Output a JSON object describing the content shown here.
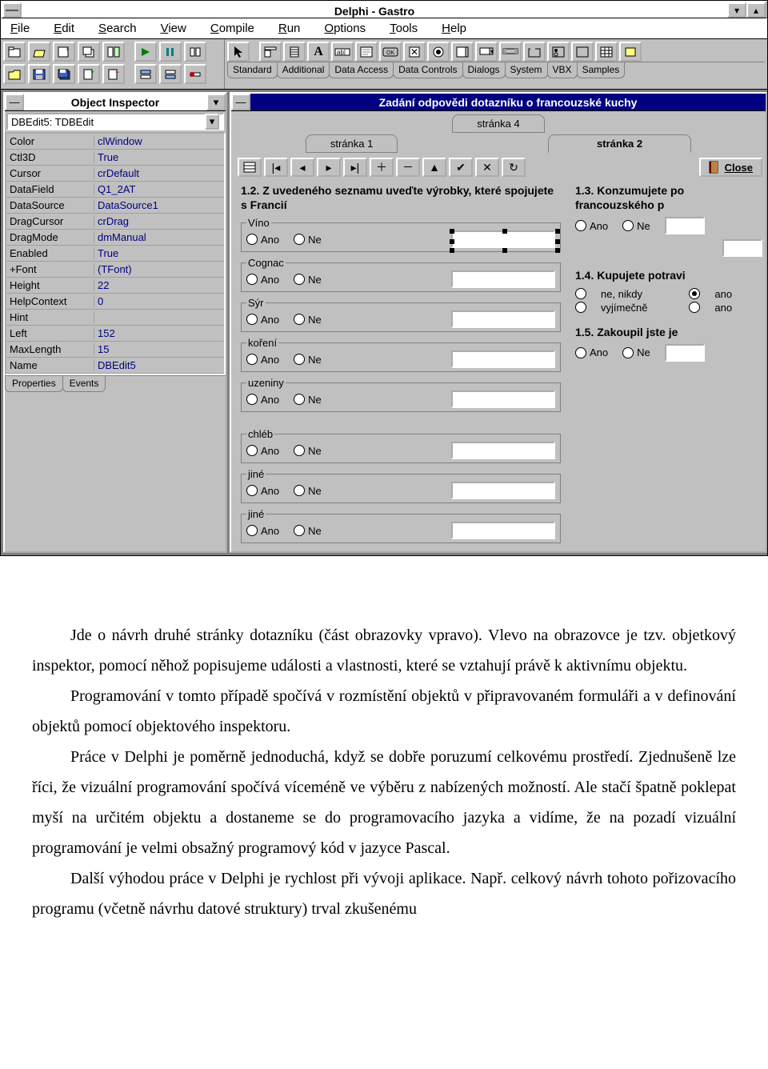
{
  "main_title": "Delphi - Gastro",
  "menu": [
    "File",
    "Edit",
    "Search",
    "View",
    "Compile",
    "Run",
    "Options",
    "Tools",
    "Help"
  ],
  "palette_tabs": [
    "Standard",
    "Additional",
    "Data Access",
    "Data Controls",
    "Dialogs",
    "System",
    "VBX",
    "Samples"
  ],
  "inspector": {
    "title": "Object Inspector",
    "selected": "DBEdit5: TDBEdit",
    "props": [
      {
        "k": "Color",
        "v": "clWindow"
      },
      {
        "k": "Ctl3D",
        "v": "True"
      },
      {
        "k": "Cursor",
        "v": "crDefault"
      },
      {
        "k": "DataField",
        "v": "Q1_2AT"
      },
      {
        "k": "DataSource",
        "v": "DataSource1"
      },
      {
        "k": "DragCursor",
        "v": "crDrag"
      },
      {
        "k": "DragMode",
        "v": "dmManual"
      },
      {
        "k": "Enabled",
        "v": "True"
      },
      {
        "k": "+Font",
        "v": "(TFont)"
      },
      {
        "k": "Height",
        "v": "22"
      },
      {
        "k": "HelpContext",
        "v": "0"
      },
      {
        "k": "Hint",
        "v": ""
      },
      {
        "k": "Left",
        "v": "152"
      },
      {
        "k": "MaxLength",
        "v": "15"
      },
      {
        "k": "Name",
        "v": "DBEdit5"
      }
    ],
    "tabs": [
      "Properties",
      "Events"
    ]
  },
  "form": {
    "title": "Zadání odpovědi dotazníku o francouzské kuchy",
    "page4": "stránka 4",
    "page1": "stránka 1",
    "page2": "stránka 2",
    "close": "Close",
    "q12": "1.2. Z uvedeného seznamu uveďte výrobky, které spojujete s Francií",
    "q13": "1.3. Konzumujete po francouzského p",
    "q14": "1.4. Kupujete potravi",
    "q15": "1.5. Zakoupil jste je",
    "items": [
      "Víno",
      "Cognac",
      "Sýr",
      "koření",
      "uzeniny",
      "chléb",
      "jiné",
      "jiné"
    ],
    "yes": "Ano",
    "no": "Ne",
    "opt14": [
      "ne, nikdy",
      "vyjímečně",
      "ano",
      "ano"
    ]
  },
  "article": {
    "p1": "Jde o návrh druhé stránky dotazníku (část obrazovky vpravo). Vlevo na obrazovce je tzv. objetkový inspektor, pomocí něhož popisujeme události  a vlastnosti, které se vztahují právě k aktivnímu objektu.",
    "p2": "Programování v tomto případě spočívá v rozmístění objektů v připravovaném formuláři a v definování objektů pomocí objektového inspektoru.",
    "p3": "Práce v Delphi je poměrně jednoduchá, když se dobře poruzumí celkovému prostředí. Zjednušeně lze říci, že vizuální programování spočívá víceméně ve výběru z nabízených možností. Ale stačí špatně poklepat myší na určitém objektu a dostaneme se do programovacího jazyka  a vidíme, že na pozadí vizuální programování je velmi obsažný programový kód v jazyce Pascal.",
    "p4": "Další výhodou práce v Delphi je rychlost při vývoji aplikace. Např. celkový návrh tohoto pořizovacího programu (včetně návrhu datové struktury) trval zkušenému"
  }
}
